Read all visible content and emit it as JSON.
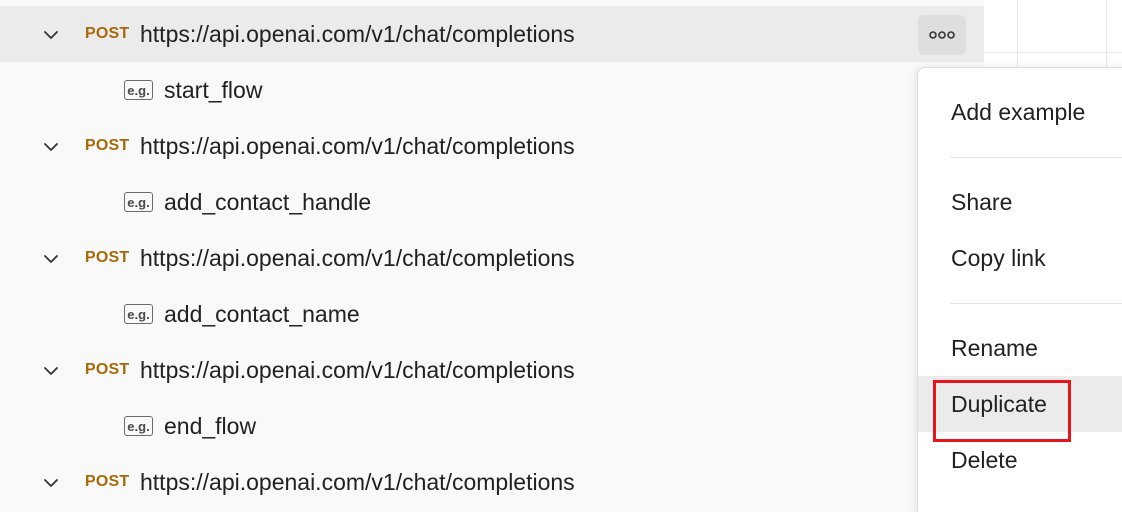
{
  "tree": {
    "rows": [
      {
        "kind": "request",
        "method": "POST",
        "url": "https://api.openai.com/v1/chat/completions",
        "selected": true
      },
      {
        "kind": "example",
        "badge": "e.g.",
        "name": "start_flow"
      },
      {
        "kind": "request",
        "method": "POST",
        "url": "https://api.openai.com/v1/chat/completions"
      },
      {
        "kind": "example",
        "badge": "e.g.",
        "name": "add_contact_handle"
      },
      {
        "kind": "request",
        "method": "POST",
        "url": "https://api.openai.com/v1/chat/completions"
      },
      {
        "kind": "example",
        "badge": "e.g.",
        "name": "add_contact_name"
      },
      {
        "kind": "request",
        "method": "POST",
        "url": "https://api.openai.com/v1/chat/completions"
      },
      {
        "kind": "example",
        "badge": "e.g.",
        "name": "end_flow"
      },
      {
        "kind": "request",
        "method": "POST",
        "url": "https://api.openai.com/v1/chat/completions"
      }
    ],
    "more_icon": "more-horizontal-icon",
    "chevron_icon": "chevron-down-icon"
  },
  "context_menu": {
    "items": [
      {
        "label": "Add example"
      },
      {
        "label": "Share"
      },
      {
        "label": "Copy link"
      },
      {
        "label": "Rename"
      },
      {
        "label": "Duplicate",
        "hovered": true,
        "highlighted": true
      },
      {
        "label": "Delete"
      }
    ]
  },
  "colors": {
    "method_post": "#a8690b",
    "selected_row": "#ebebeb",
    "highlight": "#e8141c"
  }
}
